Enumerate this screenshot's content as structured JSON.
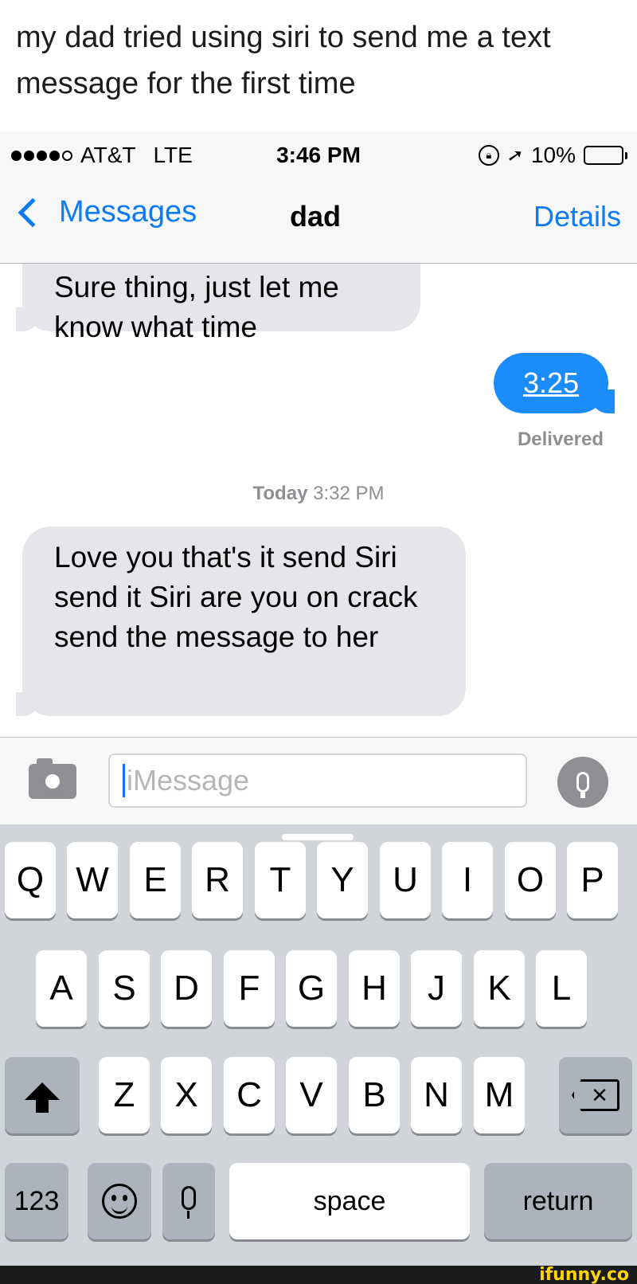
{
  "caption": "my dad tried using siri to send me a text message for the first time",
  "status_bar": {
    "carrier": "AT&T",
    "network": "LTE",
    "time": "3:46 PM",
    "battery": "10%",
    "battery_level": 0.1,
    "signal_icon": "signal-dots-icon",
    "lock_icon": "orientation-lock-icon",
    "location_icon": "location-arrow-icon"
  },
  "nav": {
    "back_label": "Messages",
    "title": "dad",
    "details_label": "Details"
  },
  "conversation": {
    "messages": [
      {
        "direction": "incoming",
        "text": "Sure thing, just let me know what time"
      },
      {
        "direction": "outgoing",
        "text": "3:25",
        "status": "Delivered"
      },
      {
        "direction": "incoming",
        "text": "Love you that's it send Siri send it Siri are you on crack send the message to her"
      }
    ],
    "timestamp_day": "Today",
    "timestamp_time": "3:32 PM"
  },
  "input": {
    "placeholder": "iMessage",
    "camera_icon": "camera-icon",
    "mic_icon": "microphone-icon"
  },
  "keyboard": {
    "row1": [
      "Q",
      "W",
      "E",
      "R",
      "T",
      "Y",
      "U",
      "I",
      "O",
      "P"
    ],
    "row2": [
      "A",
      "S",
      "D",
      "F",
      "G",
      "H",
      "J",
      "K",
      "L"
    ],
    "row3": [
      "Z",
      "X",
      "C",
      "V",
      "B",
      "N",
      "M"
    ],
    "numbers_key": "123",
    "space_key": "space",
    "return_key": "return",
    "shift_icon": "shift-arrow-icon",
    "delete_icon": "delete-backspace-icon",
    "emoji_icon": "emoji-face-icon",
    "dictation_icon": "microphone-icon"
  },
  "watermark": "ifunny.co",
  "colors": {
    "accent_blue": "#0b7cf5",
    "outgoing_bubble": "#1a8cfb",
    "incoming_bubble": "#e5e5ea",
    "keyboard_bg": "#d1d4d9",
    "battery_low": "#e0242b",
    "watermark": "#ffd400"
  }
}
